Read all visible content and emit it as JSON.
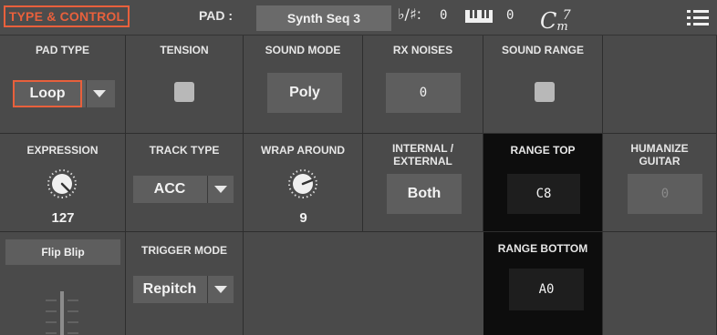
{
  "topbar": {
    "title": "TYPE & CONTROL",
    "pad_label": "PAD :",
    "pad_value": "Synth Seq 3",
    "key_symbol": "♭/♯:",
    "key_value": "0",
    "octave_value": "0",
    "chord_root": "C",
    "chord_quality": "m",
    "chord_ext": "7",
    "menu_icon": "hamburger-menu-icon"
  },
  "row1": {
    "pad_type": {
      "label": "PAD TYPE",
      "value": "Loop"
    },
    "tension": {
      "label": "TENSION",
      "checked": false
    },
    "sound_mode": {
      "label": "SOUND MODE",
      "value": "Poly"
    },
    "rx_noises": {
      "label": "RX NOISES",
      "value": "0"
    },
    "sound_range": {
      "label": "SOUND RANGE",
      "checked": false
    }
  },
  "row2": {
    "expression": {
      "label": "EXPRESSION",
      "value": "127"
    },
    "track_type": {
      "label": "TRACK TYPE",
      "value": "ACC"
    },
    "wrap_around": {
      "label": "WRAP AROUND",
      "value": "9"
    },
    "internal_external": {
      "label_line1": "INTERNAL /",
      "label_line2": "EXTERNAL",
      "value": "Both"
    },
    "range_top": {
      "label": "RANGE TOP",
      "value": "C8"
    },
    "humanize_guitar": {
      "label_line1": "HUMANIZE",
      "label_line2": "GUITAR",
      "value": "0"
    }
  },
  "row3": {
    "flip_blip": {
      "label": "Flip Blip"
    },
    "trigger_mode": {
      "label": "TRIGGER MODE",
      "value": "Repitch"
    },
    "range_bottom": {
      "label": "RANGE BOTTOM",
      "value": "A0"
    }
  },
  "colors": {
    "accent": "#e8603c",
    "background": "#4a4a4a",
    "control": "#5e5e5e",
    "dark_cell": "#0d0d0d"
  }
}
